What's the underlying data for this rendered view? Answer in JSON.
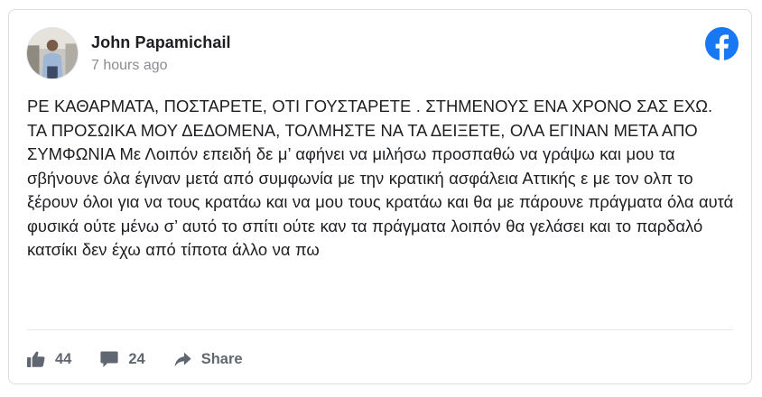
{
  "post": {
    "author": "John Papamichail",
    "timestamp": "7 hours ago",
    "text": "ΡΕ ΚΑΘΑΡΜΑΤΑ, ΠΟΣΤΑΡΕΤΕ, ΟΤΙ ΓΟΥΣΤΑΡΕΤΕ . ΣΤΗΜΕΝΟΥΣ ΕΝΑ ΧΡΟΝΟ ΣΑΣ ΕΧΩ. ΤΑ ΠΡΟΣΩΙΚΑ ΜΟΥ ΔΕΔΟΜΕΝΑ, ΤΟΛΜΗΣΤΕ ΝΑ ΤΑ ΔΕΙΞΕΤΕ, ΟΛΑ ΕΓΙΝΑΝ ΜΕΤΑ ΑΠΟ ΣΥΜΦΩΝΙΑ Με Λοιπόν επειδή δε μ’ αφήνει να μιλήσω προσπαθώ να γράψω και μου τα σβήνουνε όλα έγιναν μετά από συμφωνία με την κρατική ασφάλεια Αττικής ε με τον ολπ το ξέρουν όλοι για να τους κρατάω και να μου τους κρατάω και θα με πάρουνε πράγματα όλα αυτά φυσικά ούτε μένω σ’ αυτό το σπίτι ούτε καν τα πράγματα λοιπόν θα γελάσει και το παρδαλό κατσίκι δεν έχω από τίποτα άλλο να πω"
  },
  "actions": {
    "likes_count": "44",
    "comments_count": "24",
    "share_label": "Share"
  },
  "icons": {
    "brand": "facebook-logo-icon",
    "like": "thumbs-up-icon",
    "comment": "speech-bubble-icon",
    "share": "share-arrow-icon"
  },
  "colors": {
    "facebook_blue": "#1877f2",
    "action_gray": "#606770",
    "timestamp_gray": "#8a8d91",
    "text": "#1c1e21"
  }
}
